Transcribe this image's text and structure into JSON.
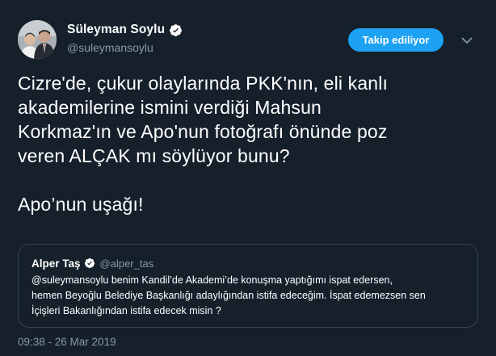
{
  "author": {
    "display_name": "Süleyman Soylu",
    "username": "@suleymansoylu",
    "verified": true,
    "avatar": "profile-photo"
  },
  "follow_button": {
    "label": "Takip ediliyor"
  },
  "menu_icon": "chevron-down-icon",
  "tweet_text": {
    "lines": [
      "Cizre'de, çukur olaylarında PKK'nın, eli kanlı",
      "akademilerine ismini verdiği Mahsun",
      "Korkmaz'ın ve Apo'nun fotoğrafı önünde poz",
      "veren ALÇAK mı söylüyor bunu?",
      "",
      "Apo’nun uşağı!"
    ]
  },
  "quoted_tweet": {
    "display_name": "Alper Taş",
    "verified": true,
    "username": "@alper_tas",
    "lines": [
      "@suleymansoylu benim Kandil’de Akademi’de konuşma yaptığımı ispat edersen,",
      "hemen Beyoğlu Belediye Başkanlığı adaylığından istifa edeceğim. İspat edemezsen sen",
      "İçişleri Bakanlığından istifa edecek misin ?"
    ]
  },
  "timestamp": "09:38 - 26 Mar 2019",
  "colors": {
    "background": "#15202b",
    "accent": "#1da1f2",
    "secondary_text": "#8899a6",
    "border": "#38444d"
  }
}
